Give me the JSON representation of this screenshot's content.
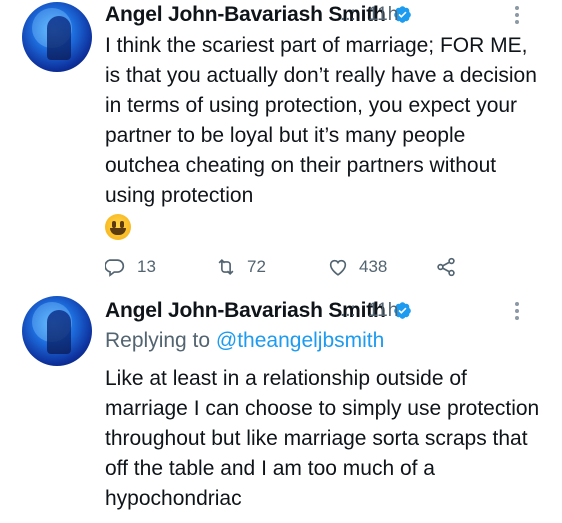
{
  "tweets": [
    {
      "author": "Angel John-Bavariash Smith",
      "verified": true,
      "separator": "..:",
      "time": "11h",
      "text": "I think the scariest part of marriage; FOR ME, is that you actually don’t really have a decision in terms of using protection, you expect your partner to be loyal but it’s many people outchea cheating on their partners without using protection",
      "emoji": "grinning-face-emoji",
      "actions": {
        "replies": "13",
        "retweets": "72",
        "likes": "438"
      }
    },
    {
      "author": "Angel John-Bavariash Smith",
      "verified": true,
      "separator": "..:",
      "time": "11h",
      "replying_to_label": "Replying to",
      "replying_to_handle": "@theangeljbsmith",
      "text": "Like at least in a relationship outside of marriage I can choose to simply use protection throughout but like marriage sorta scraps that off the table and I am too much of a hypochondriac"
    }
  ],
  "colors": {
    "text": "#0f1419",
    "secondary": "#536471",
    "accent": "#1d9bf0"
  }
}
